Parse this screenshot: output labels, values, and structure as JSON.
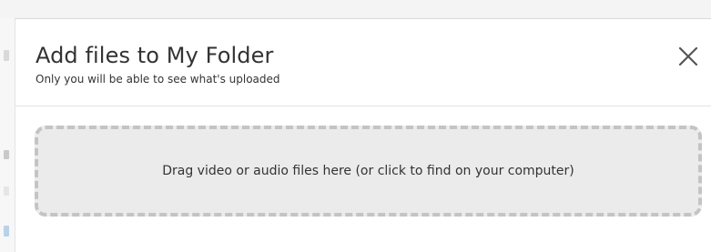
{
  "dialog": {
    "title": "Add files to My Folder",
    "subtitle": "Only you will be able to see what's uploaded",
    "close_icon": "close-icon"
  },
  "dropzone": {
    "text": "Drag video or audio files here (or click to find on your computer)"
  },
  "colors": {
    "dropzone_border": "#c4c4c4",
    "dropzone_fill": "#ebebeb",
    "text": "#333333"
  }
}
